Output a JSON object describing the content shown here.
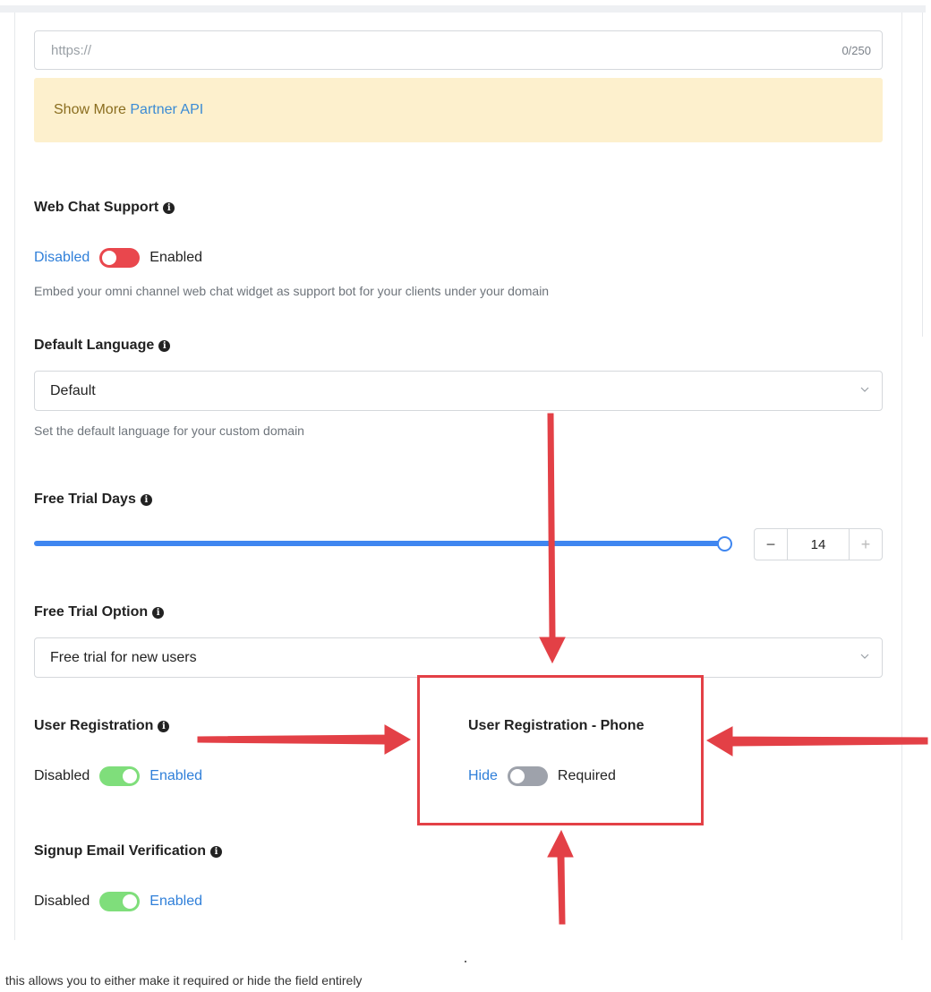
{
  "url_field": {
    "placeholder": "https://",
    "counter": "0/250"
  },
  "notice": {
    "text": "Show More",
    "link": "Partner API"
  },
  "web_chat": {
    "label": "Web Chat Support",
    "off_label": "Disabled",
    "on_label": "Enabled",
    "state": "disabled",
    "help": "Embed your omni channel web chat widget as support bot for your clients under your domain"
  },
  "default_language": {
    "label": "Default Language",
    "value": "Default",
    "help": "Set the default language for your custom domain"
  },
  "free_trial_days": {
    "label": "Free Trial Days",
    "value": "14",
    "minus": "−",
    "plus": "+",
    "slider_fraction": 1.0
  },
  "free_trial_option": {
    "label": "Free Trial Option",
    "value": "Free trial for new users"
  },
  "user_registration": {
    "label": "User Registration",
    "off_label": "Disabled",
    "on_label": "Enabled",
    "state": "enabled"
  },
  "user_registration_phone": {
    "label": "User Registration - Phone",
    "off_label": "Hide",
    "on_label": "Required",
    "state": "hide"
  },
  "signup_email_verification": {
    "label": "Signup Email Verification",
    "off_label": "Disabled",
    "on_label": "Enabled",
    "state": "enabled"
  },
  "caption": "this allows you to either make it required or hide the field entirely",
  "colors": {
    "accent_blue": "#3f86f0",
    "link_blue": "#2f7fd9",
    "toggle_off_red": "#e9474d",
    "toggle_on_green": "#7fde7b",
    "toggle_neutral_grey": "#9ea2ab",
    "annotation_red": "#e34046",
    "notice_bg": "#fdf0cd"
  },
  "icons": {
    "info": "info-circle-icon",
    "chevron": "chevron-down-icon"
  }
}
